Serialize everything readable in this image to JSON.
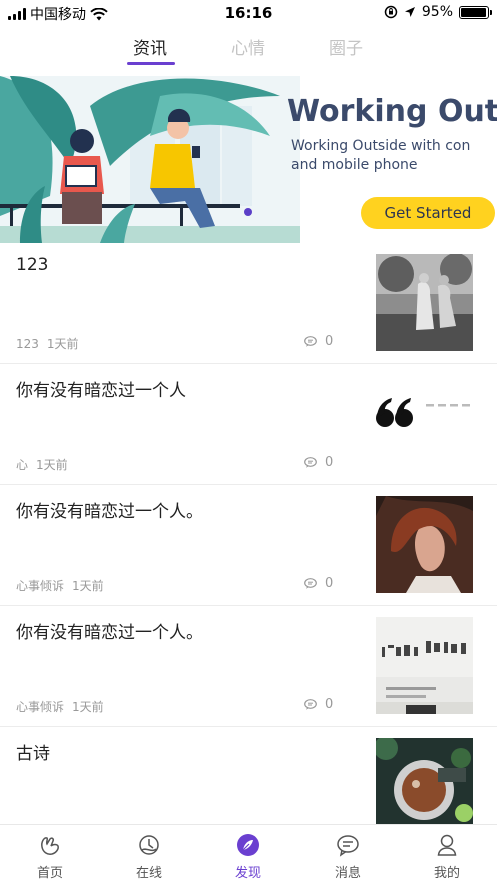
{
  "status_bar": {
    "carrier": "中国移动",
    "time": "16:16",
    "battery_text": "95%",
    "battery_level": 0.95,
    "icons": [
      "signal-icon",
      "wifi-icon",
      "orientation-lock-icon",
      "location-icon",
      "battery-icon"
    ]
  },
  "top_tabs": [
    {
      "label": "资讯",
      "active": true
    },
    {
      "label": "心情",
      "active": false
    },
    {
      "label": "圈子",
      "active": false
    }
  ],
  "banner": {
    "title": "Working Outs",
    "subtitle": "Working Outside with con\nand mobile phone",
    "button_label": "Get Started"
  },
  "feed": [
    {
      "title": "123",
      "category": "123",
      "time": "1天前",
      "comments": "0",
      "thumb": "photo-park-women"
    },
    {
      "title": "你有没有暗恋过一个人",
      "category": "心",
      "time": "1天前",
      "comments": "0",
      "thumb": "quote-marks"
    },
    {
      "title": "你有没有暗恋过一个人。",
      "category": "心事倾诉",
      "time": "1天前",
      "comments": "0",
      "thumb": "photo-woman-portrait"
    },
    {
      "title": "你有没有暗恋过一个人。",
      "category": "心事倾诉",
      "time": "1天前",
      "comments": "0",
      "thumb": "photo-calligraphy"
    },
    {
      "title": "古诗",
      "category": "",
      "time": "",
      "comments": "",
      "thumb": "photo-tea-table"
    }
  ],
  "bottom_nav": [
    {
      "label": "首页",
      "icon": "home-icon",
      "active": false
    },
    {
      "label": "在线",
      "icon": "online-icon",
      "active": false
    },
    {
      "label": "发现",
      "icon": "discover-icon",
      "active": true
    },
    {
      "label": "消息",
      "icon": "message-icon",
      "active": false
    },
    {
      "label": "我的",
      "icon": "profile-icon",
      "active": false
    }
  ],
  "colors": {
    "accent": "#6a3fd0",
    "banner_button": "#ffd21f",
    "banner_text": "#3b4a6b"
  }
}
